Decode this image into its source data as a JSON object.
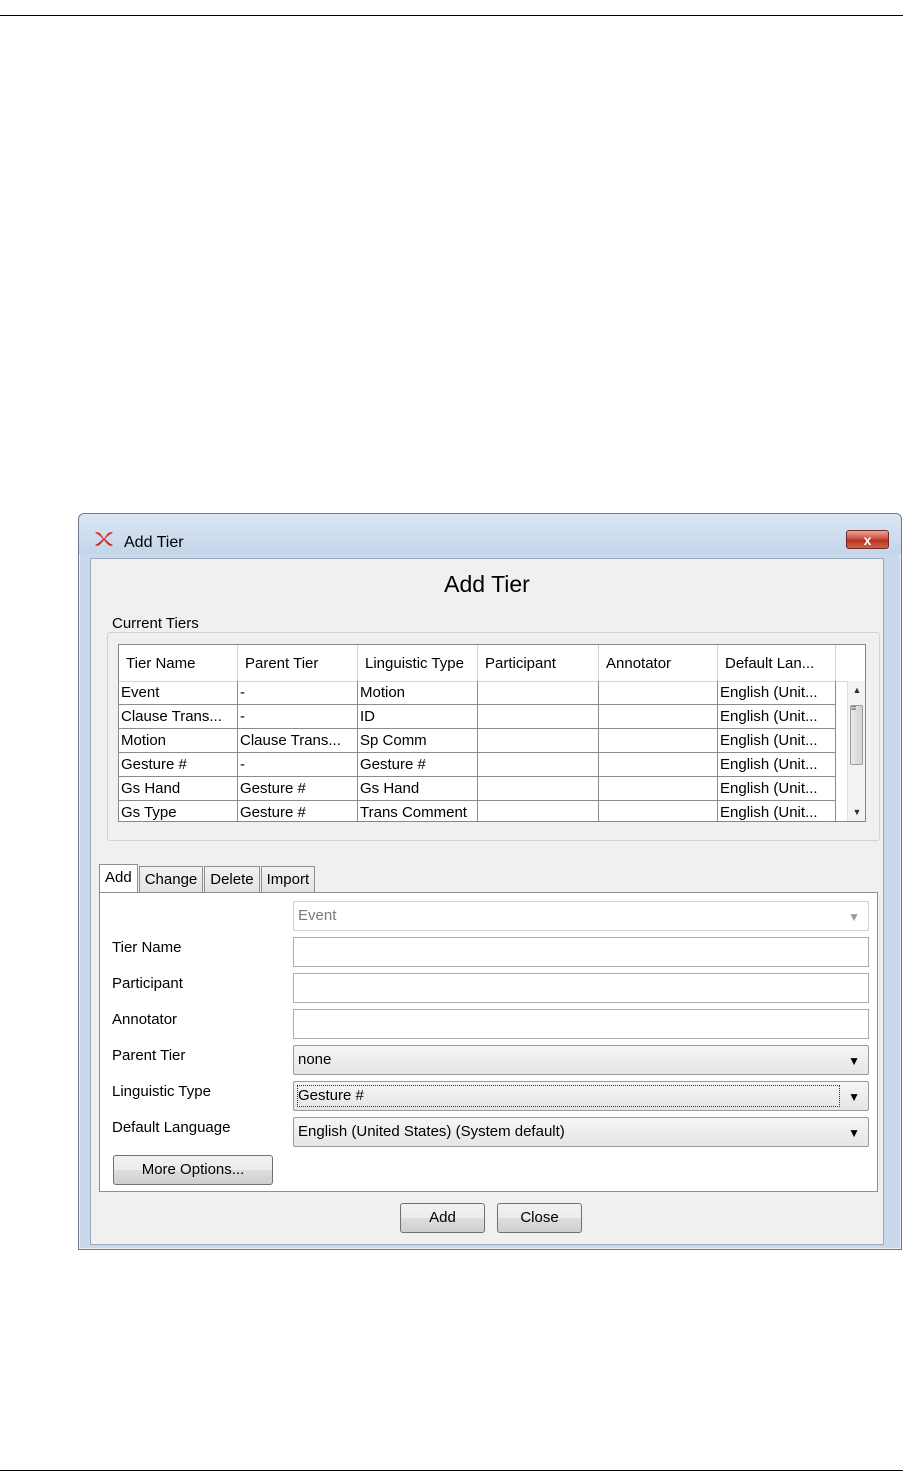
{
  "window": {
    "title": "Add Tier",
    "close_label": "x",
    "heading": "Add Tier"
  },
  "current_tiers": {
    "label": "Current Tiers",
    "columns": [
      "Tier Name",
      "Parent Tier",
      "Linguistic Type",
      "Participant",
      "Annotator",
      "Default Lan..."
    ],
    "rows": [
      [
        "Event",
        "-",
        "Motion",
        "",
        "",
        "English (Unit..."
      ],
      [
        "Clause Trans...",
        "-",
        "ID",
        "",
        "",
        "English (Unit..."
      ],
      [
        "Motion",
        "Clause Trans...",
        "Sp Comm",
        "",
        "",
        "English (Unit..."
      ],
      [
        "Gesture #",
        "-",
        "Gesture #",
        "",
        "",
        "English (Unit..."
      ],
      [
        "Gs Hand",
        "Gesture #",
        "Gs Hand",
        "",
        "",
        "English (Unit..."
      ],
      [
        "Gs Type",
        "Gesture #",
        "Trans Comment",
        "",
        "",
        "English (Unit..."
      ]
    ]
  },
  "tabs": [
    "Add",
    "Change",
    "Delete",
    "Import"
  ],
  "form": {
    "tier_select_value": "Event",
    "tier_name_label": "Tier Name",
    "tier_name_value": "",
    "participant_label": "Participant",
    "participant_value": "",
    "annotator_label": "Annotator",
    "annotator_value": "",
    "parent_tier_label": "Parent Tier",
    "parent_tier_value": "none",
    "linguistic_type_label": "Linguistic Type",
    "linguistic_type_value": "Gesture #",
    "default_language_label": "Default Language",
    "default_language_value": "English (United States) (System default)",
    "more_options_label": "More Options..."
  },
  "buttons": {
    "add_label": "Add",
    "close_label": "Close"
  }
}
